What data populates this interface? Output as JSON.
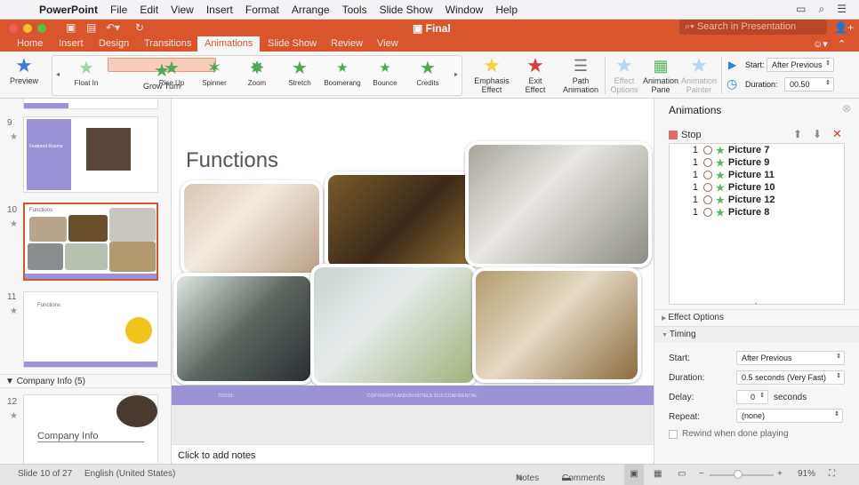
{
  "menubar": {
    "app": "PowerPoint",
    "items": [
      "File",
      "Edit",
      "View",
      "Insert",
      "Format",
      "Arrange",
      "Tools",
      "Slide Show",
      "Window",
      "Help"
    ],
    "icons": [
      "airplay-icon",
      "spotlight-search-icon",
      "notification-list-icon"
    ]
  },
  "titlebar": {
    "document_title": "Final",
    "search_placeholder": "Search in Presentation"
  },
  "tabs": [
    "Home",
    "Insert",
    "Design",
    "Transitions",
    "Animations",
    "Slide Show",
    "Review",
    "View"
  ],
  "active_tab": "Animations",
  "ribbon": {
    "preview_label": "Preview",
    "gallery": [
      {
        "label": "Float In",
        "selected": false
      },
      {
        "label": "Grow  Turn",
        "selected": true
      },
      {
        "label": "Rise Up",
        "selected": false
      },
      {
        "label": "Spinner",
        "selected": false
      },
      {
        "label": "Zoom",
        "selected": false
      },
      {
        "label": "Stretch",
        "selected": false
      },
      {
        "label": "Boomerang",
        "selected": false
      },
      {
        "label": "Bounce",
        "selected": false
      },
      {
        "label": "Credits",
        "selected": false
      }
    ],
    "emphasis": {
      "line1": "Emphasis",
      "line2": "Effect"
    },
    "exit": {
      "line1": "Exit",
      "line2": "Effect"
    },
    "path": {
      "line1": "Path",
      "line2": "Animation"
    },
    "effect_options": {
      "line1": "Effect",
      "line2": "Options"
    },
    "animation_pane": {
      "line1": "Animation",
      "line2": "Pane"
    },
    "animation_painter": {
      "line1": "Animation",
      "line2": "Painter"
    },
    "start_label": "Start:",
    "start_value": "After Previous",
    "duration_label": "Duration:",
    "duration_value": "00.50"
  },
  "slides_panel": {
    "slides": [
      {
        "number": "9",
        "title": "Featured Rooms"
      },
      {
        "number": "10",
        "title": "Functions",
        "selected": true
      },
      {
        "number": "11",
        "title": "Functions"
      },
      {
        "number": "12",
        "title": "Company Info"
      }
    ],
    "section": "Company Info (5)"
  },
  "slide": {
    "title": "Functions",
    "footer_date": "7/22/15",
    "footer_text": "COPYRIGHT LANDON HOTELS 2015 CONFIDENTIAL"
  },
  "notes_placeholder": "Click to add notes",
  "animation_pane": {
    "title": "Animations",
    "stop_label": "Stop",
    "items": [
      {
        "order": "1",
        "name": "Picture 7"
      },
      {
        "order": "1",
        "name": "Picture 9"
      },
      {
        "order": "1",
        "name": "Picture 11"
      },
      {
        "order": "1",
        "name": "Picture 10"
      },
      {
        "order": "1",
        "name": "Picture 12"
      },
      {
        "order": "1",
        "name": "Picture 8"
      }
    ],
    "effect_options_label": "Effect Options",
    "timing_label": "Timing",
    "start_label": "Start:",
    "start_value": "After Previous",
    "duration_label": "Duration:",
    "duration_value": "0.5 seconds (Very Fast)",
    "delay_label": "Delay:",
    "delay_value": "0",
    "delay_unit": "seconds",
    "repeat_label": "Repeat:",
    "repeat_value": "(none)",
    "rewind_label": "Rewind when done playing"
  },
  "statusbar": {
    "slide_info": "Slide 10 of 27",
    "language": "English (United States)",
    "notes": "Notes",
    "comments": "Comments",
    "zoom": "91%",
    "zoom_fraction": 0.45
  },
  "colors": {
    "accent": "#d9552e",
    "slide_footer": "#9b92d8",
    "selected_gallery": "#f9cdb9"
  }
}
